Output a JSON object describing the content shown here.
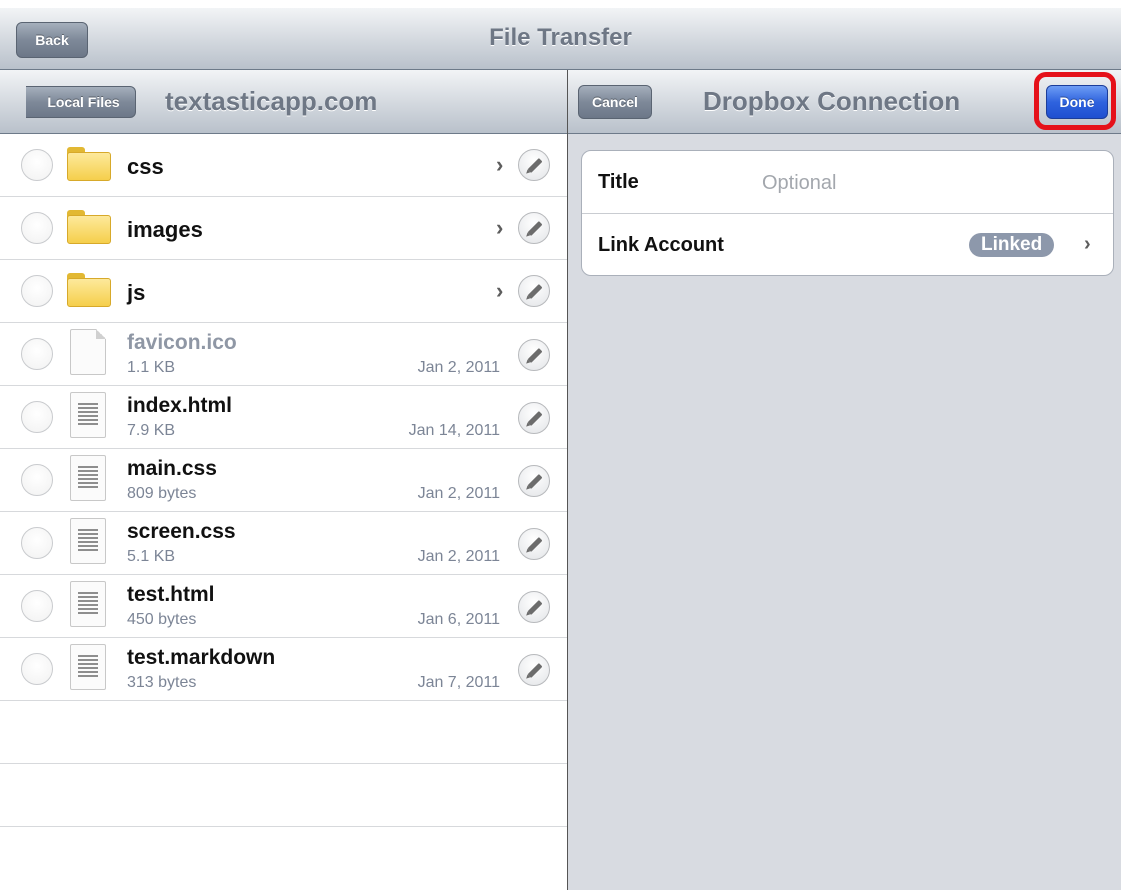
{
  "header": {
    "back_label": "Back",
    "title": "File Transfer"
  },
  "left": {
    "nav_back_label": "Local Files",
    "title": "textasticapp.com",
    "folders": [
      {
        "name": "css"
      },
      {
        "name": "images"
      },
      {
        "name": "js"
      }
    ],
    "files": [
      {
        "name": "favicon.ico",
        "size": "1.1 KB",
        "date": "Jan 2, 2011",
        "dim": true
      },
      {
        "name": "index.html",
        "size": "7.9 KB",
        "date": "Jan 14, 2011"
      },
      {
        "name": "main.css",
        "size": "809 bytes",
        "date": "Jan 2, 2011"
      },
      {
        "name": "screen.css",
        "size": "5.1 KB",
        "date": "Jan 2, 2011"
      },
      {
        "name": "test.html",
        "size": "450 bytes",
        "date": "Jan 6, 2011"
      },
      {
        "name": "test.markdown",
        "size": "313 bytes",
        "date": "Jan 7, 2011"
      }
    ]
  },
  "right": {
    "cancel_label": "Cancel",
    "title": "Dropbox Connection",
    "done_label": "Done",
    "highlight_color": "#e5111a",
    "form": {
      "title_label": "Title",
      "title_placeholder": "Optional",
      "link_label": "Link Account",
      "link_status": "Linked"
    }
  },
  "colors": {
    "done_blue": "#2f63de",
    "folder_yellow": "#f5cf4c",
    "badge": "#8d98ab"
  }
}
